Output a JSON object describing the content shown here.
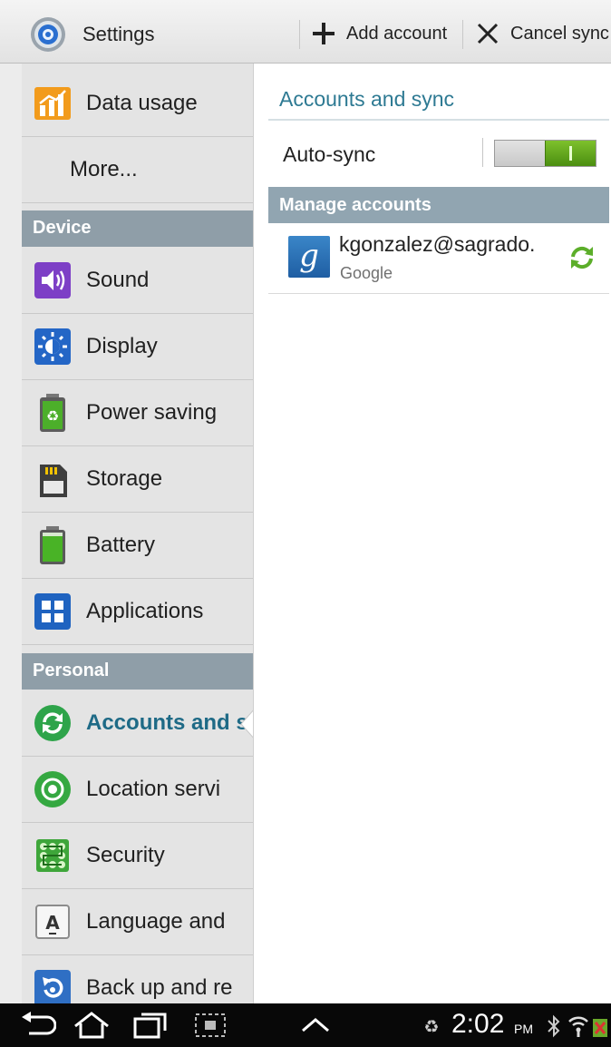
{
  "actionbar": {
    "title": "Settings",
    "add_account_label": "Add account",
    "cancel_sync_label": "Cancel sync",
    "app_icon": "settings-gear-icon"
  },
  "sidebar": {
    "items": [
      {
        "label": "Data usage",
        "icon": "data-usage-icon"
      },
      {
        "label": "More...",
        "icon": ""
      }
    ],
    "sections": [
      {
        "title": "Device",
        "items": [
          {
            "label": "Sound",
            "icon": "sound-icon"
          },
          {
            "label": "Display",
            "icon": "display-icon"
          },
          {
            "label": "Power saving",
            "icon": "power-saving-icon"
          },
          {
            "label": "Storage",
            "icon": "storage-icon"
          },
          {
            "label": "Battery",
            "icon": "battery-icon"
          },
          {
            "label": "Applications",
            "icon": "applications-icon"
          }
        ]
      },
      {
        "title": "Personal",
        "items": [
          {
            "label": "Accounts and s",
            "icon": "accounts-sync-icon",
            "selected": true
          },
          {
            "label": "Location servi",
            "icon": "location-icon"
          },
          {
            "label": "Security",
            "icon": "security-icon"
          },
          {
            "label": "Language and",
            "icon": "language-icon"
          },
          {
            "label": "Back up and re",
            "icon": "backup-icon"
          }
        ]
      }
    ]
  },
  "detail": {
    "title": "Accounts and sync",
    "auto_sync_label": "Auto-sync",
    "auto_sync_on": true,
    "manage_header": "Manage accounts",
    "account": {
      "email": "kgonzalez@sagrado.",
      "type": "Google",
      "icon_letter": "g"
    }
  },
  "statusbar": {
    "time": "2:02",
    "ampm": "PM"
  },
  "colors": {
    "accent": "#2e7a93",
    "section_header": "#8f9ea8",
    "toggle_on": "#5fa21c",
    "selected_text": "#1e6a86"
  }
}
